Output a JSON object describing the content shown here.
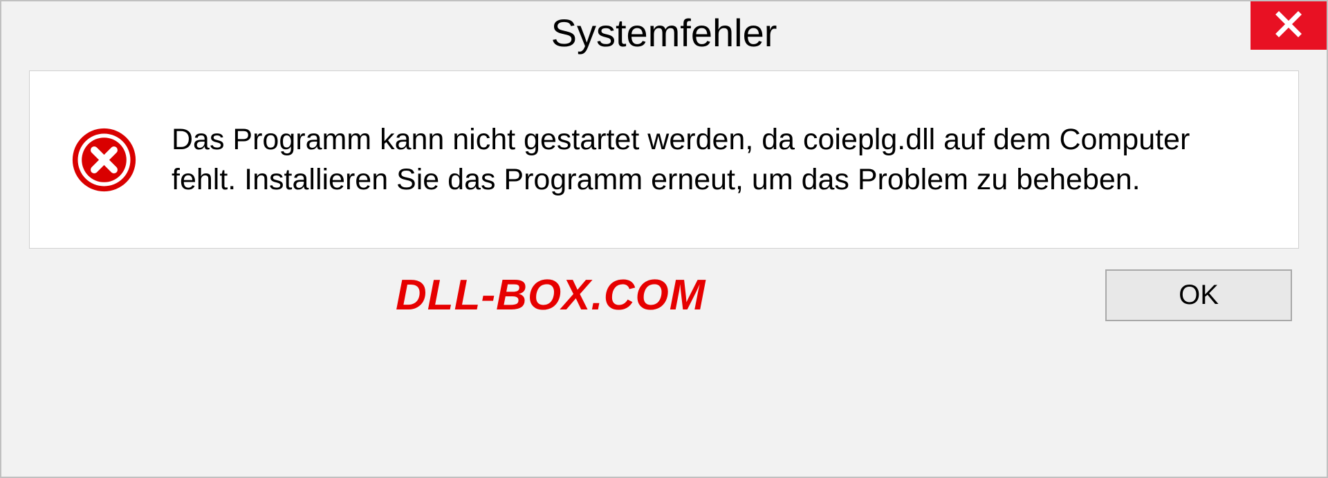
{
  "dialog": {
    "title": "Systemfehler",
    "message": "Das Programm kann nicht gestartet werden, da coieplg.dll auf dem Computer fehlt. Installieren Sie das Programm erneut, um das Problem zu beheben.",
    "ok_label": "OK"
  },
  "watermark": "DLL-BOX.COM",
  "colors": {
    "close_bg": "#e81123",
    "error_icon": "#d90000",
    "watermark": "#e60000"
  }
}
